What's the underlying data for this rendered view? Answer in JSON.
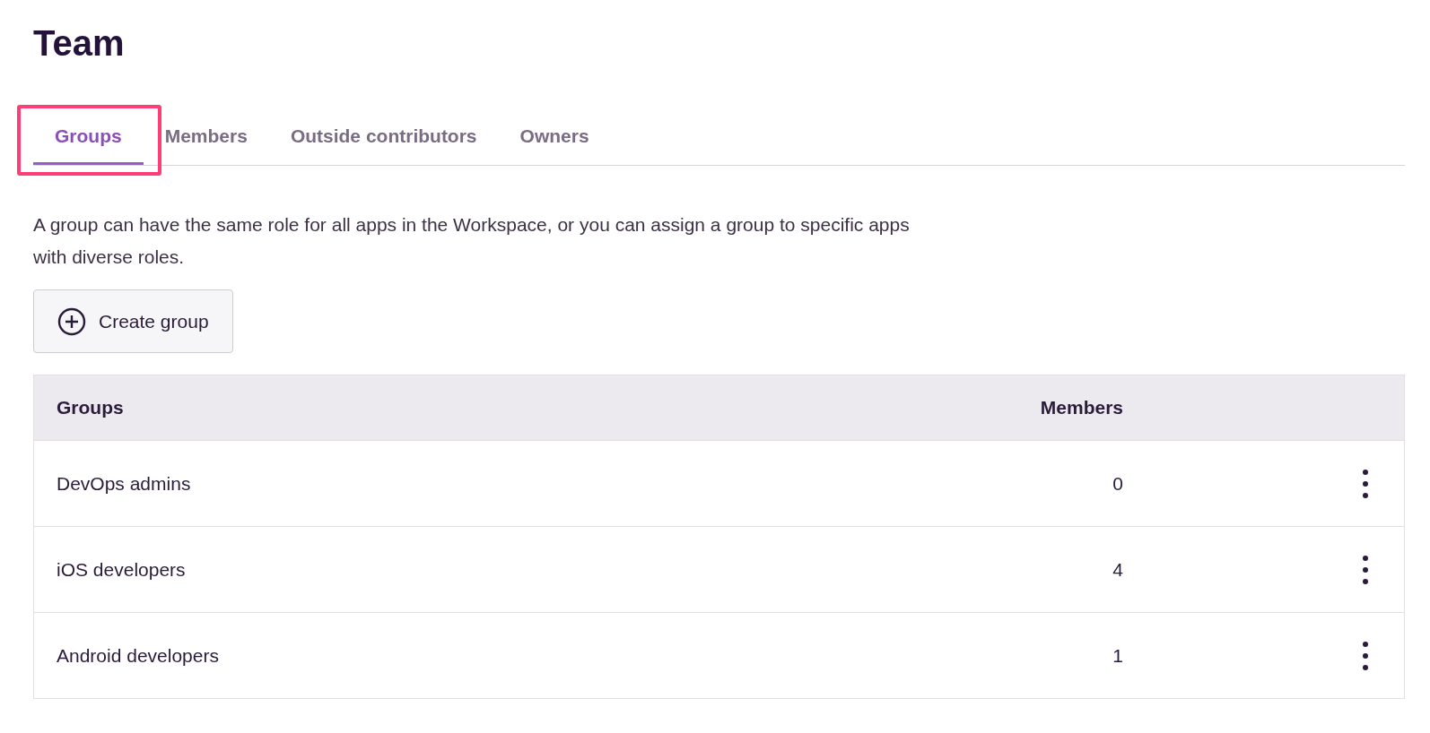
{
  "page": {
    "title": "Team"
  },
  "tabs": [
    {
      "label": "Groups",
      "selected": true,
      "highlighted": true
    },
    {
      "label": "Members",
      "selected": false,
      "highlighted": false
    },
    {
      "label": "Outside contributors",
      "selected": false,
      "highlighted": false
    },
    {
      "label": "Owners",
      "selected": false,
      "highlighted": false
    }
  ],
  "description": "A group can have the same role for all apps in the Workspace, or you can assign a group to specific apps with diverse roles.",
  "create_button": {
    "label": "Create group"
  },
  "table": {
    "columns": [
      "Groups",
      "Members"
    ],
    "rows": [
      {
        "name": "DevOps admins",
        "members": "0"
      },
      {
        "name": "iOS developers",
        "members": "4"
      },
      {
        "name": "Android developers",
        "members": "1"
      }
    ]
  }
}
